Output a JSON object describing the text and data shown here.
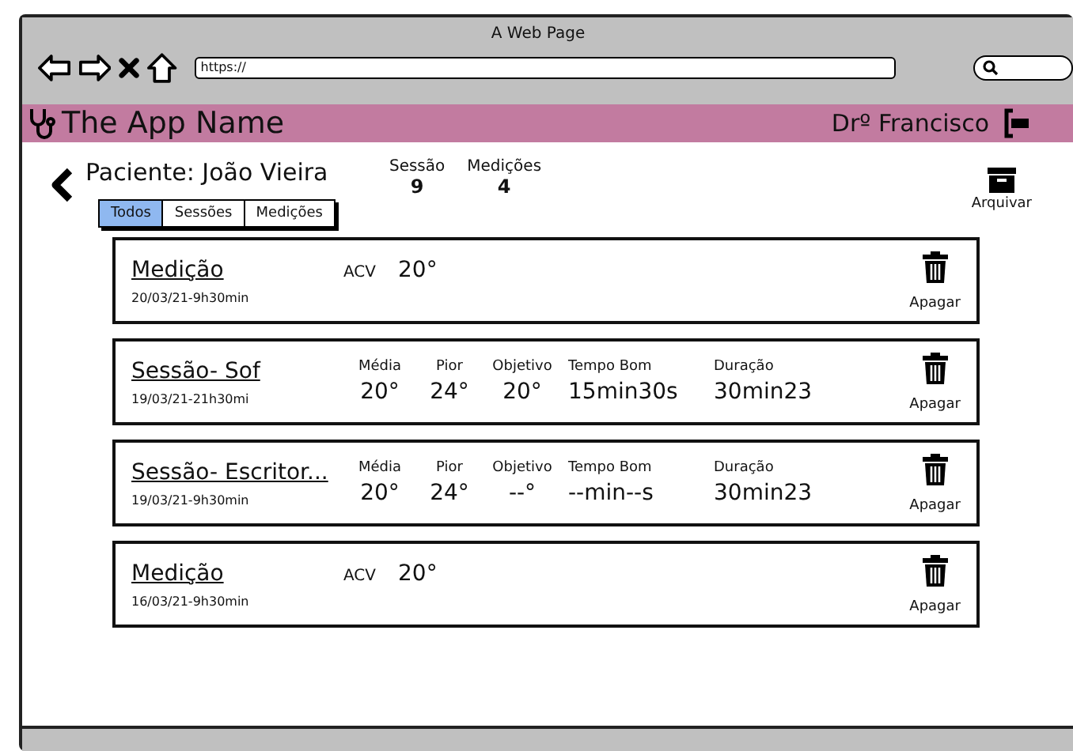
{
  "browser": {
    "title": "A Web Page",
    "url": "https://"
  },
  "header": {
    "app_name": "The App Name",
    "user": "Drº Francisco"
  },
  "patient": {
    "name": "Paciente: João Vieira",
    "stats": [
      {
        "label": "Sessão",
        "value": "9"
      },
      {
        "label": "Medições",
        "value": "4"
      }
    ],
    "archive_label": "Arquivar"
  },
  "tabs": [
    {
      "label": "Todos",
      "selected": true
    },
    {
      "label": "Sessões",
      "selected": false
    },
    {
      "label": "Medições",
      "selected": false
    }
  ],
  "records": [
    {
      "kind": "measurement",
      "title": "Medição",
      "date": "20/03/21-9h30min",
      "metrics": [
        {
          "label": "ACV",
          "value": "20°"
        }
      ],
      "delete_label": "Apagar"
    },
    {
      "kind": "session",
      "title": "Sessão- Sof",
      "date": "19/03/21-21h30mi",
      "metrics": [
        {
          "label": "Média",
          "value": "20°"
        },
        {
          "label": "Pior",
          "value": "24°"
        },
        {
          "label": "Objetivo",
          "value": "20°"
        },
        {
          "label": "Tempo Bom",
          "value": "15min30s"
        },
        {
          "label": "Duração",
          "value": "30min23"
        }
      ],
      "delete_label": "Apagar"
    },
    {
      "kind": "session",
      "title": "Sessão- Escritor...",
      "date": "19/03/21-9h30min",
      "metrics": [
        {
          "label": "Média",
          "value": "20°"
        },
        {
          "label": "Pior",
          "value": "24°"
        },
        {
          "label": "Objetivo",
          "value": "--°"
        },
        {
          "label": "Tempo Bom",
          "value": "--min--s"
        },
        {
          "label": "Duração",
          "value": "30min23"
        }
      ],
      "delete_label": "Apagar"
    },
    {
      "kind": "measurement",
      "title": "Medição",
      "date": "16/03/21-9h30min",
      "metrics": [
        {
          "label": "ACV",
          "value": "20°"
        }
      ],
      "delete_label": "Apagar"
    }
  ]
}
